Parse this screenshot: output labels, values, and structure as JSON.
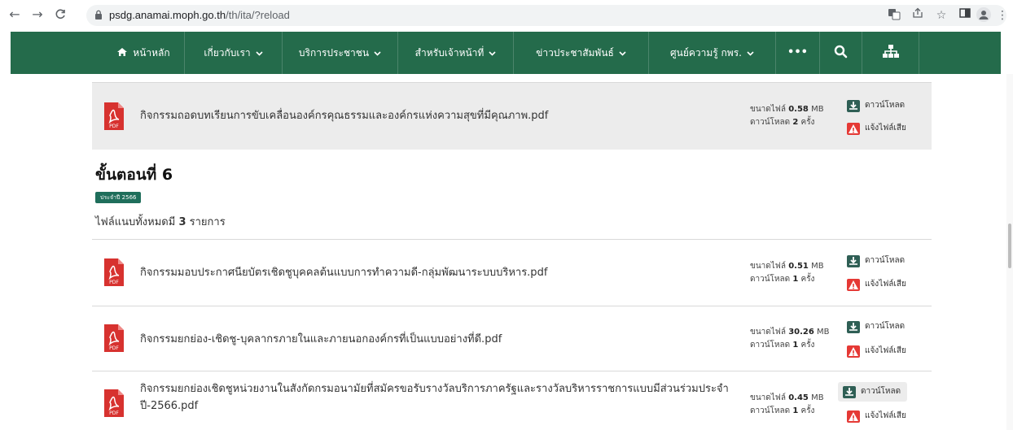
{
  "browser": {
    "url_host": "psdg.anamai.moph.go.th",
    "url_path": "/th/ita/?reload",
    "back_icon": "←",
    "forward_icon": "→",
    "reload_icon": "C"
  },
  "nav": {
    "home": "หน้าหลัก",
    "about": "เกี่ยวกับเรา",
    "services": "บริการประชาชน",
    "staff": "สำหรับเจ้าหน้าที่",
    "news": "ข่าวประชาสัมพันธ์",
    "knowledge": "ศูนย์ความรู้ กพร.",
    "more": "•••",
    "chevron": "⌄",
    "bar_color": "#246b4b"
  },
  "top_file": {
    "name": "กิจกรรมถอดบทเรียนการขับเคลื่อนองค์กรคุณธรรมและองค์กรแห่งความสุขที่มีคุณภาพ.pdf",
    "size_label": "ขนาดไฟล์",
    "size": "0.58",
    "size_unit": "MB",
    "dl_label": "ดาวน์โหลด",
    "dl_count": "2",
    "dl_unit": "ครั้ง"
  },
  "section": {
    "title": "ขั้นตอนที่ 6",
    "year_badge": "ประจำปี 2566",
    "total_prefix": "ไฟล์แนบทั้งหมดมี",
    "total_count": "3",
    "total_suffix": "รายการ"
  },
  "actions": {
    "download": "ดาวน์โหลด",
    "report": "แจ้งไฟล์เสีย"
  },
  "files": [
    {
      "name": "กิจกรรมมอบประกาศนียบัตรเชิดชูบุคคลต้นแบบการทำความดี-กลุ่มพัฒนาระบบบริหาร.pdf",
      "size_label": "ขนาดไฟล์",
      "size": "0.51",
      "size_unit": "MB",
      "dl_label": "ดาวน์โหลด",
      "dl_count": "1",
      "dl_unit": "ครั้ง"
    },
    {
      "name": "กิจกรรมยกย่อง-เชิดชู-บุคลากรภายในและภายนอกองค์กรที่เป็นแบบอย่างที่ดี.pdf",
      "size_label": "ขนาดไฟล์",
      "size": "30.26",
      "size_unit": "MB",
      "dl_label": "ดาวน์โหลด",
      "dl_count": "1",
      "dl_unit": "ครั้ง"
    },
    {
      "name_line1": "กิจกรรมยกย่องเชิดชูหน่วยงานในสังกัดกรมอนามัยที่สมัครขอรับรางวัลบริการภาครัฐและรางวัลบริหารราชการแบบมีส่วนร่วมประจำ",
      "name_line2": "ปี-2566.pdf",
      "size_label": "ขนาดไฟล์",
      "size": "0.45",
      "size_unit": "MB",
      "dl_label": "ดาวน์โหลด",
      "dl_count": "1",
      "dl_unit": "ครั้ง"
    }
  ],
  "colors": {
    "pdf_red": "#d7322f",
    "download_icon": "#2f5f55",
    "report_icon": "#e53935",
    "badge": "#1f6e5b"
  }
}
